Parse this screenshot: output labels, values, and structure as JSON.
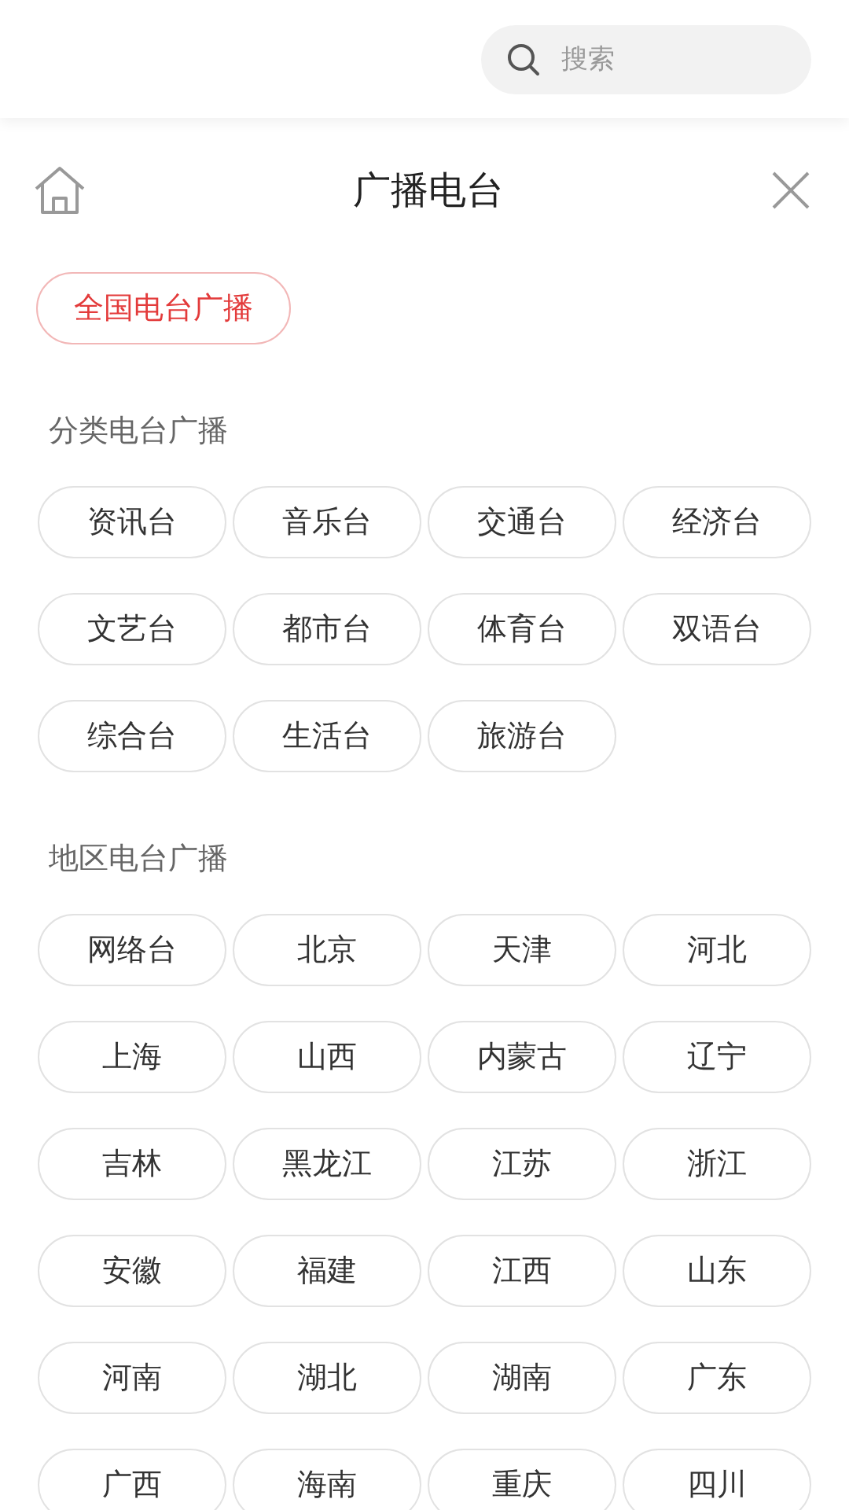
{
  "search": {
    "placeholder": "搜索"
  },
  "header": {
    "title": "广播电台"
  },
  "featured": {
    "label": "全国电台广播",
    "selected": true
  },
  "sections": [
    {
      "title": "分类电台广播",
      "items": [
        "资讯台",
        "音乐台",
        "交通台",
        "经济台",
        "文艺台",
        "都市台",
        "体育台",
        "双语台",
        "综合台",
        "生活台",
        "旅游台"
      ]
    },
    {
      "title": "地区电台广播",
      "items": [
        "网络台",
        "北京",
        "天津",
        "河北",
        "上海",
        "山西",
        "内蒙古",
        "辽宁",
        "吉林",
        "黑龙江",
        "江苏",
        "浙江",
        "安徽",
        "福建",
        "江西",
        "山东",
        "河南",
        "湖北",
        "湖南",
        "广东",
        "广西",
        "海南",
        "重庆",
        "四川"
      ]
    }
  ]
}
